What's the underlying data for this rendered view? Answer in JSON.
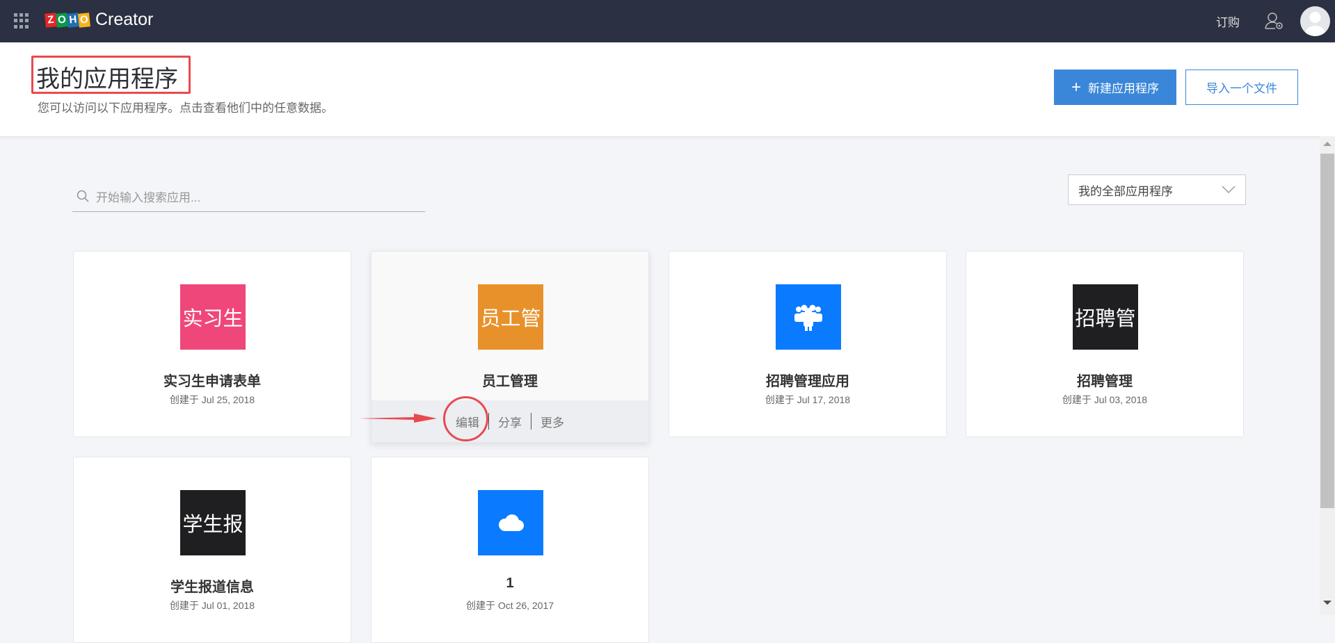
{
  "topbar": {
    "brand_logo": "ZOHO",
    "brand_product": "Creator",
    "order_label": "订购"
  },
  "header": {
    "title": "我的应用程序",
    "subtitle": "您可以访问以下应用程序。点击查看他们中的任意数据。",
    "new_app_label": "新建应用程序",
    "import_label": "导入一个文件"
  },
  "search": {
    "placeholder": "开始输入搜索应用..."
  },
  "filter": {
    "selected": "我的全部应用程序"
  },
  "apps": [
    {
      "icon_text": "实习生",
      "name": "实习生申请表单",
      "date": "创建于 Jul 25, 2018",
      "color": "#f0477a"
    },
    {
      "icon_text": "员工管",
      "name": "员工管理",
      "date": "",
      "color": "#e8912a"
    },
    {
      "icon_text": "",
      "icon": "people-group-icon",
      "name": "招聘管理应用",
      "date": "创建于 Jul 17, 2018",
      "color": "#0a7bff"
    },
    {
      "icon_text": "招聘管",
      "name": "招聘管理",
      "date": "创建于 Jul 03, 2018",
      "color": "#1f1f22"
    },
    {
      "icon_text": "学生报",
      "name": "学生报道信息",
      "date": "创建于 Jul 01, 2018",
      "color": "#1f1f22"
    },
    {
      "icon_text": "",
      "icon": "cloud-icon",
      "name": "1",
      "date": "创建于 Oct 26, 2017",
      "color": "#0a7bff"
    }
  ],
  "card_actions": {
    "edit": "编辑",
    "share": "分享",
    "more": "更多"
  }
}
